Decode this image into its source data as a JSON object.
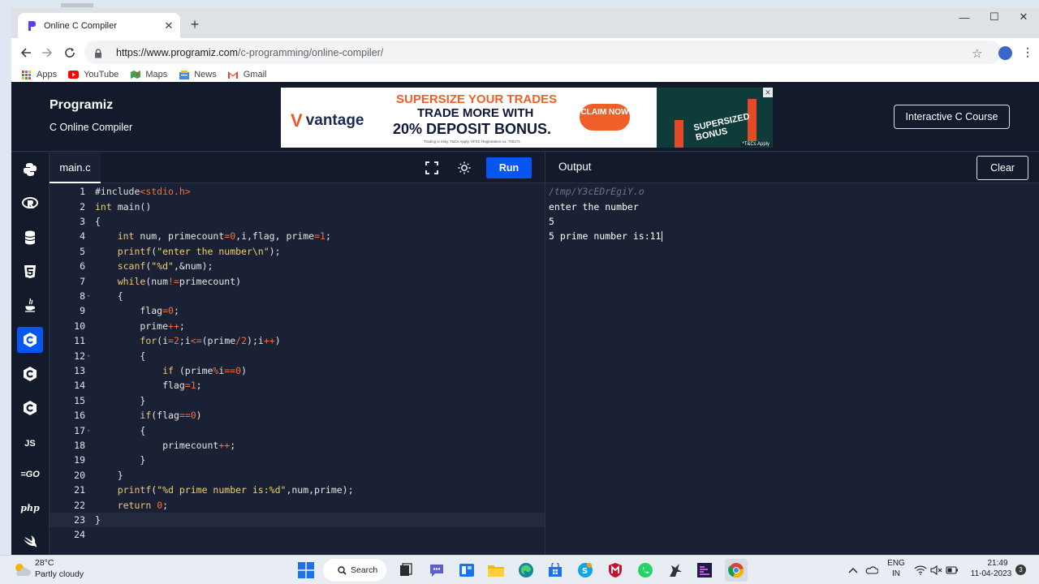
{
  "browser": {
    "tab_title": "Online C Compiler",
    "url_host": "https://www.programiz.com",
    "url_path": "/c-programming/online-compiler/",
    "bookmarks": [
      "Apps",
      "YouTube",
      "Maps",
      "News",
      "Gmail"
    ]
  },
  "site": {
    "logo": "Programiz",
    "subtitle": "C Online Compiler",
    "course_button": "Interactive C Course",
    "ad": {
      "brand": "vantage",
      "line1": "SUPERSIZE YOUR TRADES",
      "line2": "TRADE MORE WITH",
      "line3": "20% DEPOSIT BONUS.",
      "fine": "Trading is risky. T&Cs Apply. VFSC Registration no. 700271",
      "claim": "CLAIM NOW",
      "promo": "SUPERSIZED BONUS",
      "tc": "*T&Cs Apply"
    },
    "sidebar_labels": {
      "js": "JS",
      "go": "GO",
      "php": "php"
    },
    "file_tab": "main.c",
    "run_button": "Run",
    "output_title": "Output",
    "clear_button": "Clear"
  },
  "code_lines": [
    "#include<stdio.h>",
    "int main()",
    "{",
    "    int num, primecount=0,i,flag, prime=1;",
    "    printf(\"enter the number\\n\");",
    "    scanf(\"%d\",&num);",
    "    while(num!=primecount)",
    "    {",
    "        flag=0;",
    "        prime++;",
    "        for(i=2;i<=(prime/2);i++)",
    "        {",
    "            if (prime%i==0)",
    "            flag=1;",
    "        }",
    "        if(flag==0)",
    "        {",
    "            primecount++;",
    "        }",
    "    }",
    "    printf(\"%d prime number is:%d\",num,prime);",
    "    return 0;",
    "}",
    ""
  ],
  "output_lines": [
    "/tmp/Y3cEDrEgiY.o",
    "enter the number",
    "5",
    "5 prime number is:11"
  ],
  "taskbar": {
    "temperature": "28°C",
    "weather": "Partly cloudy",
    "search": "Search",
    "lang1": "ENG",
    "lang2": "IN",
    "time": "21:49",
    "date": "11-04-2023",
    "notifications": "3"
  },
  "colors": {
    "accent": "#0556f3",
    "editor_bg": "#1a2134",
    "header_bg": "#121a2b"
  }
}
